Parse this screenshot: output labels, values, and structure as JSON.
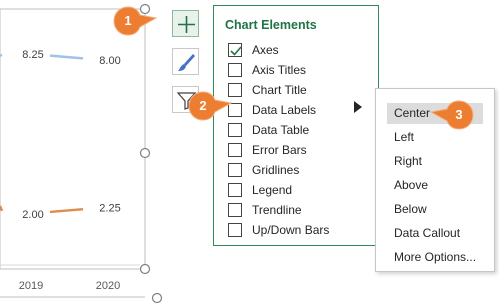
{
  "colors": {
    "accent": "#217346",
    "panel_border": "#2e8b57",
    "callout": "#ed7d31",
    "series_top": "#9dc3e6",
    "series_bottom": "#e08a4e"
  },
  "chart_data": {
    "type": "line",
    "x": [
      "2019",
      "2020"
    ],
    "series": [
      {
        "values": [
          8.25,
          8.0
        ],
        "labels": [
          "8.25",
          "8.00"
        ]
      },
      {
        "values": [
          2.0,
          2.25
        ],
        "labels": [
          "2.00",
          "2.25"
        ]
      }
    ],
    "ylim": [
      0,
      10
    ],
    "grid": false,
    "legend": "none"
  },
  "tools": [
    {
      "name": "plus-icon"
    },
    {
      "name": "brush-icon"
    },
    {
      "name": "filter-icon"
    }
  ],
  "panel": {
    "title": "Chart Elements",
    "items": [
      {
        "label": "Axes",
        "checked": true
      },
      {
        "label": "Axis Titles",
        "checked": false
      },
      {
        "label": "Chart Title",
        "checked": false
      },
      {
        "label": "Data Labels",
        "checked": false
      },
      {
        "label": "Data Table",
        "checked": false
      },
      {
        "label": "Error Bars",
        "checked": false
      },
      {
        "label": "Gridlines",
        "checked": false
      },
      {
        "label": "Legend",
        "checked": false
      },
      {
        "label": "Trendline",
        "checked": false
      },
      {
        "label": "Up/Down Bars",
        "checked": false
      }
    ]
  },
  "submenu": {
    "items": [
      "Center",
      "Left",
      "Right",
      "Above",
      "Below",
      "Data Callout",
      "More Options..."
    ],
    "highlighted": "Center"
  },
  "callouts": [
    "1",
    "2",
    "3"
  ]
}
